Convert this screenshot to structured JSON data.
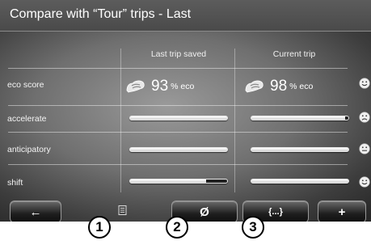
{
  "title": "Compare with “Tour” trips - Last",
  "columns": {
    "last": "Last trip saved",
    "current": "Current trip"
  },
  "rows": [
    {
      "label": "eco score"
    },
    {
      "label": "accelerate",
      "last_level": 1.0,
      "current_level": 0.97
    },
    {
      "label": "anticipatory",
      "last_level": 1.0,
      "current_level": 1.0
    },
    {
      "label": "shift",
      "last_level": 0.78,
      "current_level": 1.0
    }
  ],
  "eco_score": {
    "last_value": "93",
    "current_value": "98",
    "unit": "% eco"
  },
  "smileys": [
    "smile",
    "frown",
    "neutral",
    "smile"
  ],
  "buttons": {
    "back": "←",
    "average": "Ø",
    "reset": "{...}",
    "add": "+"
  },
  "callouts": [
    "1",
    "2",
    "3"
  ],
  "colors": {
    "title_bar": "#4f4f4f",
    "bar_fill": "#f2f2f2",
    "bar_empty": "#222222"
  }
}
